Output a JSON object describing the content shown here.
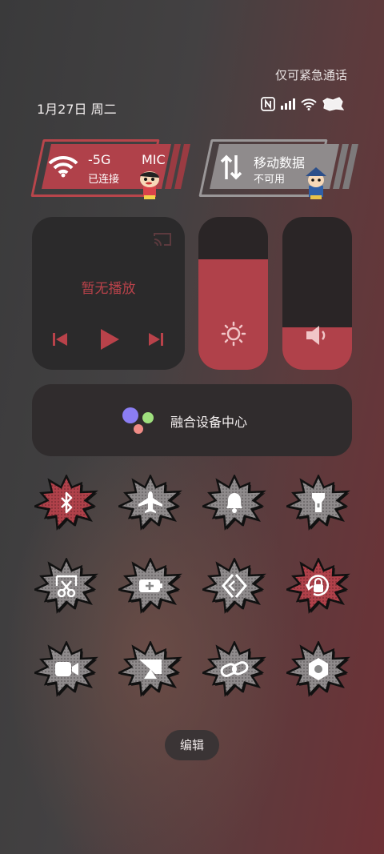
{
  "status_bar": {
    "emergency_text": "仅可紧急通话",
    "date_text": "1月27日 周二",
    "icons": [
      "nfc-icon",
      "signal-icon",
      "wifi-icon",
      "battery-icon"
    ]
  },
  "tiles": {
    "wifi": {
      "title": "-5G",
      "extra": "MIC",
      "subtitle": "已连接",
      "active": true
    },
    "mobile_data": {
      "title": "移动数据",
      "subtitle": "不可用",
      "active": false
    }
  },
  "media": {
    "status": "暂无播放"
  },
  "sliders": {
    "brightness": {
      "level": 0.72
    },
    "volume": {
      "level": 0.28
    }
  },
  "fusion": {
    "label": "融合设备中心"
  },
  "toggles": [
    {
      "name": "bluetooth",
      "active": true
    },
    {
      "name": "airplane",
      "active": false
    },
    {
      "name": "bell",
      "active": false
    },
    {
      "name": "flashlight",
      "active": false
    },
    {
      "name": "screenshot",
      "active": false
    },
    {
      "name": "battery-saver",
      "active": false
    },
    {
      "name": "nearby-share",
      "active": false
    },
    {
      "name": "rotation-lock",
      "active": true
    },
    {
      "name": "screen-record",
      "active": false
    },
    {
      "name": "screencast",
      "active": false
    },
    {
      "name": "link",
      "active": false
    },
    {
      "name": "settings",
      "active": false
    }
  ],
  "edit_label": "编辑",
  "colors": {
    "accent": "#b0414a",
    "tile_dark": "#2b2a2b",
    "tile_grey": "#8f8b8c"
  }
}
